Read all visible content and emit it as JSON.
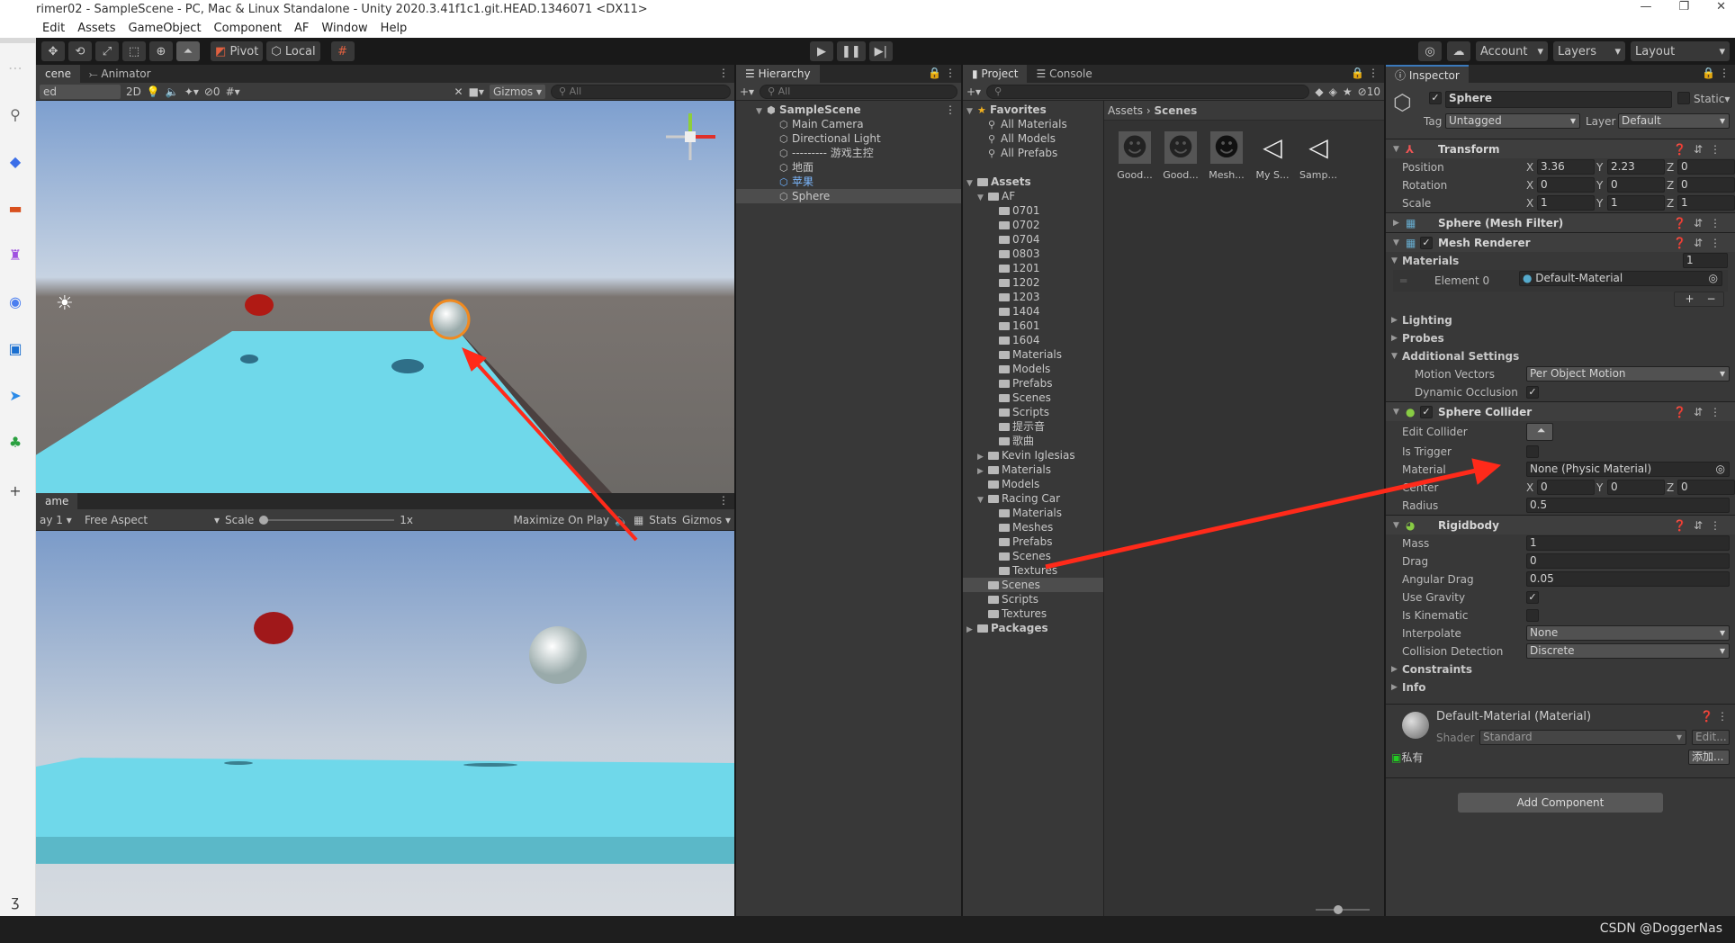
{
  "window": {
    "title": "rimer02 - SampleScene - PC, Mac & Linux Standalone - Unity 2020.3.41f1c1.git.HEAD.1346071 <DX11>",
    "min": "—",
    "max": "❐",
    "close": "✕"
  },
  "menu": [
    "Edit",
    "Assets",
    "GameObject",
    "Component",
    "AF",
    "Window",
    "Help"
  ],
  "toolbar": {
    "pivot": "Pivot",
    "local": "Local",
    "account": "Account",
    "layers": "Layers",
    "layout": "Layout"
  },
  "scene": {
    "tabs": [
      "cene",
      "Animator"
    ],
    "draw_mode": "ed",
    "mode2d": "2D",
    "hidden_count": "0",
    "gizmos": "Gizmos",
    "search_placeholder": "All"
  },
  "game": {
    "tab": "ame",
    "display": "ay 1",
    "aspect": "Free Aspect",
    "scale_label": "Scale",
    "scale_value": "1x",
    "maximize": "Maximize On Play",
    "stats": "Stats",
    "gizmos": "Gizmos"
  },
  "hierarchy": {
    "tab": "Hierarchy",
    "search_placeholder": "All",
    "items": [
      {
        "label": "SampleScene",
        "depth": 0,
        "type": "scene",
        "bold": true
      },
      {
        "label": "Main Camera",
        "depth": 1
      },
      {
        "label": "Directional Light",
        "depth": 1
      },
      {
        "label": "--------- 游戏主控",
        "depth": 1
      },
      {
        "label": "地面",
        "depth": 1
      },
      {
        "label": "苹果",
        "depth": 1,
        "prefab": true
      },
      {
        "label": "Sphere",
        "depth": 1,
        "selected": true
      }
    ]
  },
  "project": {
    "tabs": [
      "Project",
      "Console"
    ],
    "hidden_count": "10",
    "breadcrumb": [
      "Assets",
      "Scenes"
    ],
    "tree": [
      {
        "label": "Favorites",
        "depth": 0,
        "open": true,
        "icon": "star",
        "bold": true
      },
      {
        "label": "All Materials",
        "depth": 1,
        "icon": "search"
      },
      {
        "label": "All Models",
        "depth": 1,
        "icon": "search"
      },
      {
        "label": "All Prefabs",
        "depth": 1,
        "icon": "search"
      },
      {
        "label": "",
        "depth": 0,
        "spacer": true
      },
      {
        "label": "Assets",
        "depth": 0,
        "open": true,
        "bold": true
      },
      {
        "label": "AF",
        "depth": 1,
        "open": true
      },
      {
        "label": "0701",
        "depth": 2
      },
      {
        "label": "0702",
        "depth": 2
      },
      {
        "label": "0704",
        "depth": 2
      },
      {
        "label": "0803",
        "depth": 2
      },
      {
        "label": "1201",
        "depth": 2
      },
      {
        "label": "1202",
        "depth": 2
      },
      {
        "label": "1203",
        "depth": 2
      },
      {
        "label": "1404",
        "depth": 2
      },
      {
        "label": "1601",
        "depth": 2
      },
      {
        "label": "1604",
        "depth": 2
      },
      {
        "label": "Materials",
        "depth": 2
      },
      {
        "label": "Models",
        "depth": 2
      },
      {
        "label": "Prefabs",
        "depth": 2
      },
      {
        "label": "Scenes",
        "depth": 2
      },
      {
        "label": "Scripts",
        "depth": 2
      },
      {
        "label": "提示音",
        "depth": 2
      },
      {
        "label": "歌曲",
        "depth": 2
      },
      {
        "label": "Kevin Iglesias",
        "depth": 1,
        "closed": true
      },
      {
        "label": "Materials",
        "depth": 1,
        "closed": true
      },
      {
        "label": "Models",
        "depth": 1
      },
      {
        "label": "Racing Car",
        "depth": 1,
        "open": true
      },
      {
        "label": "Materials",
        "depth": 2
      },
      {
        "label": "Meshes",
        "depth": 2
      },
      {
        "label": "Prefabs",
        "depth": 2
      },
      {
        "label": "Scenes",
        "depth": 2
      },
      {
        "label": "Textures",
        "depth": 2
      },
      {
        "label": "Scenes",
        "depth": 1,
        "selected": true
      },
      {
        "label": "Scripts",
        "depth": 1
      },
      {
        "label": "Textures",
        "depth": 1
      },
      {
        "label": "Packages",
        "depth": 0,
        "closed": true,
        "bold": true
      }
    ],
    "assets": [
      {
        "label": "Good...",
        "kind": "model"
      },
      {
        "label": "Good...",
        "kind": "model"
      },
      {
        "label": "Mesh...",
        "kind": "model-dark"
      },
      {
        "label": "My S...",
        "kind": "unity"
      },
      {
        "label": "Samp...",
        "kind": "unity"
      }
    ]
  },
  "inspector": {
    "tab": "Inspector",
    "name": "Sphere",
    "static": "Static",
    "tag_label": "Tag",
    "tag": "Untagged",
    "layer_label": "Layer",
    "layer": "Default",
    "rows": [
      {
        "t": "hdr",
        "label": "Transform",
        "icon": "transform"
      },
      {
        "t": "vec",
        "label": "Position",
        "v": [
          "3.36",
          "2.23",
          "0"
        ]
      },
      {
        "t": "vec",
        "label": "Rotation",
        "v": [
          "0",
          "0",
          "0"
        ]
      },
      {
        "t": "vec",
        "label": "Scale",
        "v": [
          "1",
          "1",
          "1"
        ]
      },
      {
        "t": "hdr",
        "label": "Sphere (Mesh Filter)",
        "icon": "mesh",
        "closed": true
      },
      {
        "t": "hdr",
        "label": "Mesh Renderer",
        "icon": "mesh",
        "check": true
      },
      {
        "t": "fold",
        "label": "Materials",
        "open": true,
        "value": "1"
      },
      {
        "t": "elem",
        "label": "Element 0",
        "value": "Default-Material"
      },
      {
        "t": "pm",
        "plus": "+",
        "minus": "−"
      },
      {
        "t": "fold",
        "label": "Lighting"
      },
      {
        "t": "fold",
        "label": "Probes"
      },
      {
        "t": "fold",
        "label": "Additional Settings",
        "open": true
      },
      {
        "t": "dd",
        "label": "Motion Vectors",
        "value": "Per Object Motion",
        "indent": true
      },
      {
        "t": "chk",
        "label": "Dynamic Occlusion",
        "checked": true,
        "indent": true
      },
      {
        "t": "hdr",
        "label": "Sphere Collider",
        "icon": "collider",
        "check": true
      },
      {
        "t": "btn",
        "label": "Edit Collider"
      },
      {
        "t": "chk",
        "label": "Is Trigger",
        "checked": false
      },
      {
        "t": "obj",
        "label": "Material",
        "value": "None (Physic Material)"
      },
      {
        "t": "vec",
        "label": "Center",
        "v": [
          "0",
          "0",
          "0"
        ]
      },
      {
        "t": "fld",
        "label": "Radius",
        "value": "0.5"
      },
      {
        "t": "hdr",
        "label": "Rigidbody",
        "icon": "rigidbody"
      },
      {
        "t": "fld",
        "label": "Mass",
        "value": "1"
      },
      {
        "t": "fld",
        "label": "Drag",
        "value": "0"
      },
      {
        "t": "fld",
        "label": "Angular Drag",
        "value": "0.05"
      },
      {
        "t": "chk",
        "label": "Use Gravity",
        "checked": true
      },
      {
        "t": "chk",
        "label": "Is Kinematic",
        "checked": false
      },
      {
        "t": "dd",
        "label": "Interpolate",
        "value": "None"
      },
      {
        "t": "dd",
        "label": "Collision Detection",
        "value": "Discrete"
      },
      {
        "t": "fold",
        "label": "Constraints"
      },
      {
        "t": "fold",
        "label": "Info"
      }
    ],
    "material": {
      "title": "Default-Material (Material)",
      "shader_label": "Shader",
      "shader": "Standard",
      "edit": "Edit...",
      "private": "私有",
      "add": "添加..."
    },
    "add_component": "Add Component"
  },
  "watermark": "CSDN @DoggerNas",
  "colors": {
    "accent_red": "#ff2a1a",
    "plane": "#6fd8ea",
    "selection": "#4d4d4d"
  }
}
